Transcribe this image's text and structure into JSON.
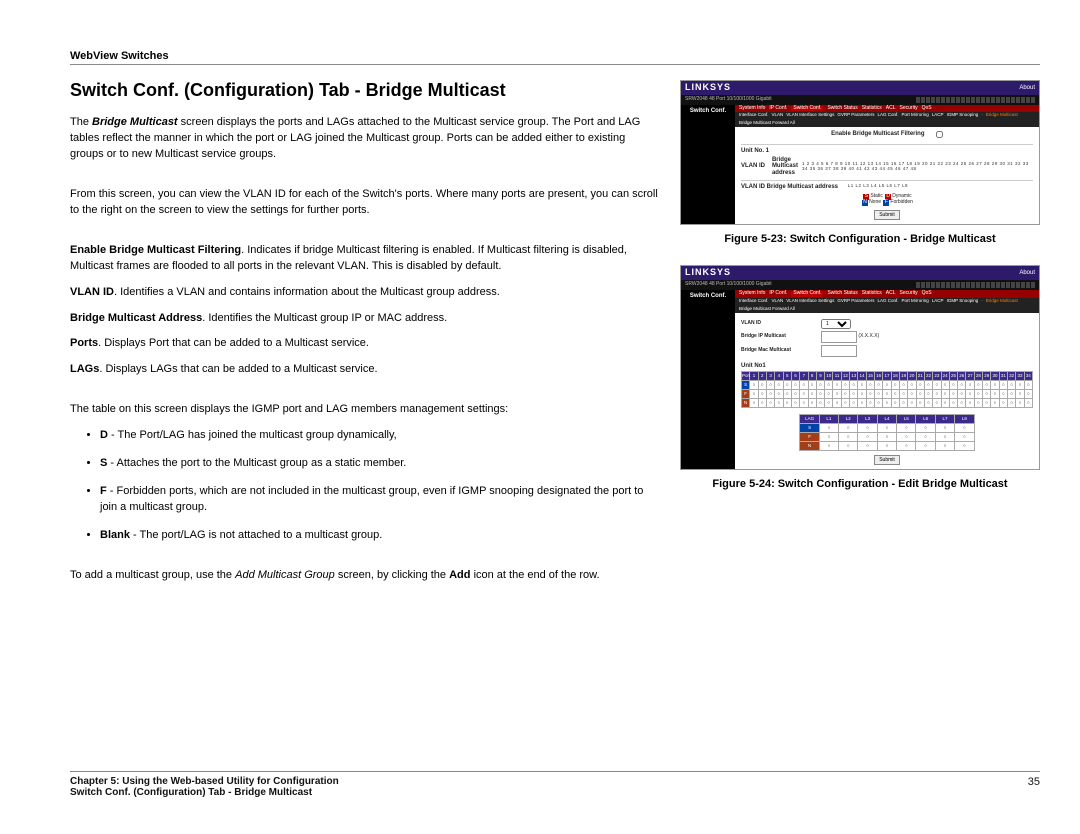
{
  "header": "WebView Switches",
  "title": "Switch Conf. (Configuration) Tab - Bridge Multicast",
  "body": {
    "p1a": "The",
    "p1b": "Bridge Multicast",
    "p1c": "screen displays the ports and LAGs attached to the Multicast service group. The Port and LAG tables reflect the manner in which the port or LAG joined the Multicast group. Ports can be added either to existing groups or to new Multicast service groups.",
    "p2": "From this screen, you can view the VLAN ID for each of the Switch's ports. Where many ports are present, you can scroll to the right on the screen to view the settings for further ports.",
    "p3a": "Enable Bridge Multicast Filtering",
    "p3b": ". Indicates if bridge Multicast filtering is enabled. If Multicast filtering is disabled, Multicast frames are flooded to all ports in the relevant VLAN. This is disabled by default.",
    "p4a": "VLAN ID",
    "p4b": ". Identifies a VLAN and contains information about the Multicast group address.",
    "p5a": "Bridge Multicast Address",
    "p5b": ". Identifies the Multicast group IP or MAC address.",
    "p6a": "Ports",
    "p6b": ". Displays Port that can be added to a Multicast service.",
    "p7a": "LAGs",
    "p7b": ". Displays LAGs that can be added to a Multicast service.",
    "p8": "The table on this screen displays the IGMP port and LAG members management settings:",
    "li1a": "D",
    "li1b": " - The Port/LAG has joined the multicast group dynamically,",
    "li2a": "S",
    "li2b": " - Attaches the port to the Multicast group as a static member.",
    "li3a": "F",
    "li3b": " - Forbidden ports, which are not included in the multicast group, even if IGMP snooping designated the port to join a multicast group.",
    "li4a": "Blank",
    "li4b": " - The port/LAG is not attached to a multicast group.",
    "p9a": "To add a multicast group, use the",
    "p9b": "Add Multicast Group",
    "p9c": "screen, by clicking the",
    "p9d": "Add",
    "p9e": "icon at the end of the row."
  },
  "fig1": {
    "logo": "LINKSYS",
    "about": "About",
    "model": "SRW2048 48 Port 10/100/1000 Gigabit",
    "sideTab": "Switch Conf.",
    "tabs": [
      "System Info",
      "IP Conf.",
      "Switch Conf.",
      "Switch Status",
      "Statistics",
      "ACL",
      "Security",
      "QoS"
    ],
    "sub": [
      "Interface Conf.",
      "VLAN",
      "VLAN Interface Settings",
      "GVRP Parameters",
      "LAG Conf.",
      "Port Mirroring",
      "LACP",
      "IGMP Snooping",
      "·",
      "Bridge Multicast",
      "Bridge Multicast Forward All"
    ],
    "enableLabel": "Enable Bridge Multicast Filtering",
    "unitLabel": "Unit No. 1",
    "vlanLabel": "VLAN ID",
    "bmHeader": "Bridge Multicast address",
    "portNums": "1 2 3 4 5 6 7 8 9 10 11 12 13 14 15 16 17 18 19 20 21 22 23 24 25 26 27 28 29 30 31 32 33 34 35 36 37 38 39 40 41 42 43 44 45 46 47 48",
    "vlanBmLabel": "VLAN ID Bridge Multicast address",
    "lagNums": "L1  L2  L3  L4  L5  L6  L7  L8",
    "legend": [
      "Static",
      "Dynamic",
      "None",
      "Forbidden"
    ],
    "submit": "Submit",
    "caption": "Figure 5-23: Switch Configuration - Bridge Multicast"
  },
  "fig2": {
    "logo": "LINKSYS",
    "about": "About",
    "model": "SRW2048 48 Port 10/100/1000 Gigabit",
    "sideTab": "Switch Conf.",
    "tabs": [
      "System Info",
      "IP Conf.",
      "Switch Conf.",
      "Switch Status",
      "Statistics",
      "ACL",
      "Security",
      "QoS"
    ],
    "sub": [
      "Interface Conf.",
      "VLAN",
      "VLAN Interface Settings",
      "GVRP Parameters",
      "LAG Conf.",
      "Port Mirroring",
      "LACP",
      "IGMP Snooping",
      "·",
      "Bridge Multicast",
      "Bridge Multicast Forward All"
    ],
    "f1": "VLAN ID",
    "f1v": "1",
    "f2": "Bridge IP Multicast",
    "f2h": "(X.X.X.X)",
    "f3": "Bridge Mac Multicast",
    "unitLabel": "Unit No1",
    "portHdr": "Port",
    "lagHdr": "LAG",
    "submit": "Submit",
    "caption": "Figure 5-24: Switch Configuration - Edit Bridge Multicast"
  },
  "footer": {
    "line1": "Chapter 5: Using the Web-based Utility for Configuration",
    "line2": "Switch Conf. (Configuration) Tab - Bridge Multicast",
    "page": "35"
  }
}
